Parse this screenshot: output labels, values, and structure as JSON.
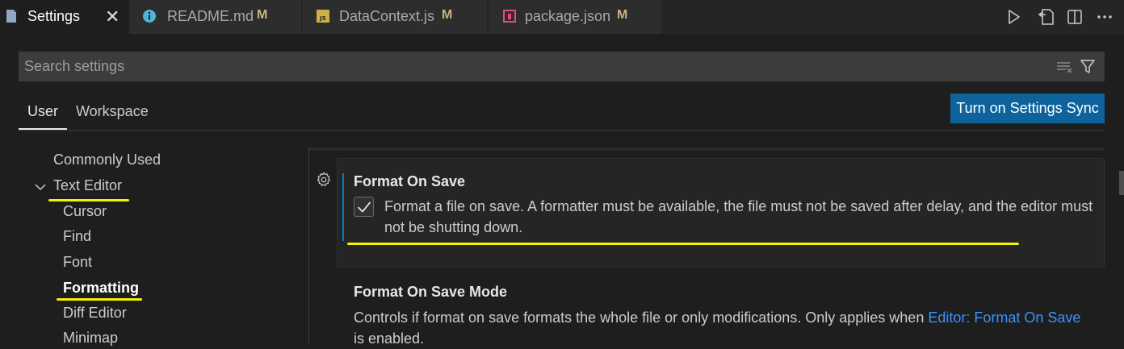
{
  "tabs": [
    {
      "label": "Settings",
      "icon": "settings-file-icon",
      "close": "✕"
    },
    {
      "label": "README.md",
      "icon": "info-icon",
      "modified": "M"
    },
    {
      "label": "DataContext.js",
      "icon": "js-file-icon",
      "modified": "M"
    },
    {
      "label": "package.json",
      "icon": "npm-package-icon",
      "modified": "M"
    }
  ],
  "toolbar_actions": [
    "run-icon",
    "open-settings-json-icon",
    "split-editor-icon",
    "more-actions-icon"
  ],
  "search": {
    "placeholder": "Search settings",
    "value": ""
  },
  "scope_tabs": {
    "user": "User",
    "workspace": "Workspace",
    "selected": "User"
  },
  "sync_button": "Turn on Settings Sync",
  "toc": {
    "commonly_used": "Commonly Used",
    "text_editor": "Text Editor",
    "children": [
      "Cursor",
      "Find",
      "Font",
      "Formatting",
      "Diff Editor",
      "Minimap"
    ],
    "selected": "Formatting"
  },
  "settings": {
    "format_on_save": {
      "title": "Format On Save",
      "description": "Format a file on save. A formatter must be available, the file must not be saved after delay, and the editor must not be shutting down.",
      "checked": true
    },
    "format_on_save_mode": {
      "title": "Format On Save Mode",
      "desc_before": "Controls if format on save formats the whole file or only modifications. Only applies when ",
      "link": "Editor: Format On Save",
      "desc_after": " is enabled."
    }
  },
  "colors": {
    "accent": "#0e639c",
    "highlight": "#f3f300",
    "link": "#3794ff",
    "modified": "#c9b37e"
  }
}
